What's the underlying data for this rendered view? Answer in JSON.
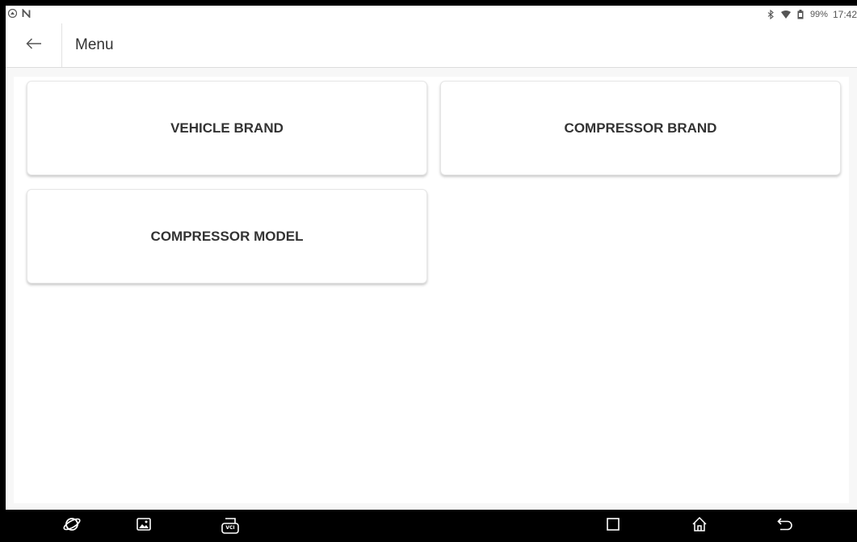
{
  "status_bar": {
    "left_icons": [
      "app-badge-icon",
      "n-notification-icon"
    ],
    "right_icons": [
      "bluetooth-icon",
      "wifi-icon",
      "battery-icon"
    ],
    "battery_percent": "99%",
    "time": "17:42"
  },
  "action_bar": {
    "back_icon": "arrow-left-icon",
    "title": "Menu"
  },
  "menu_items": [
    {
      "label": "VEHICLE BRAND"
    },
    {
      "label": "COMPRESSOR BRAND"
    },
    {
      "label": "COMPRESSOR MODEL"
    }
  ],
  "nav_bar": {
    "left_icons": [
      "browser-icon",
      "gallery-icon",
      "vci-icon"
    ],
    "vci_label": "VCI",
    "right_icons": [
      "recents-icon",
      "home-icon",
      "back-icon"
    ]
  },
  "colors": {
    "text": "#333333",
    "background": "#f7f7f7",
    "card": "#ffffff",
    "frame": "#000000"
  }
}
